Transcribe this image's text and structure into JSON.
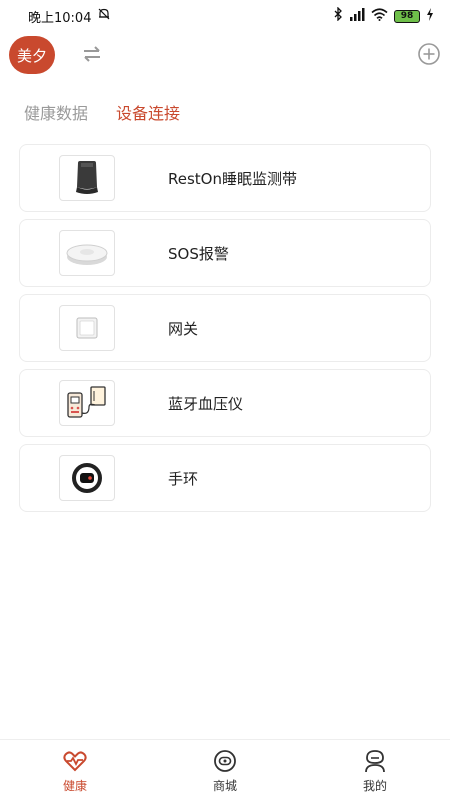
{
  "status_bar": {
    "time": "晚上10:04",
    "battery": "98"
  },
  "header": {
    "avatar_text": "美夕"
  },
  "tabs": [
    {
      "label": "健康数据",
      "active": false
    },
    {
      "label": "设备连接",
      "active": true
    }
  ],
  "devices": [
    {
      "name": "RestOn睡眠监测带",
      "icon": "sleep-monitor-belt-icon"
    },
    {
      "name": "SOS报警",
      "icon": "sos-alarm-icon"
    },
    {
      "name": "网关",
      "icon": "gateway-icon"
    },
    {
      "name": "蓝牙血压仪",
      "icon": "blood-pressure-monitor-icon"
    },
    {
      "name": "手环",
      "icon": "wristband-icon"
    }
  ],
  "bottom_nav": [
    {
      "label": "健康",
      "icon": "heart-pulse-icon",
      "active": true
    },
    {
      "label": "商城",
      "icon": "store-icon",
      "active": false
    },
    {
      "label": "我的",
      "icon": "profile-icon",
      "active": false
    }
  ],
  "colors": {
    "accent": "#c9492e",
    "inactive_text": "#9a9a9a",
    "card_border": "#ececec"
  }
}
